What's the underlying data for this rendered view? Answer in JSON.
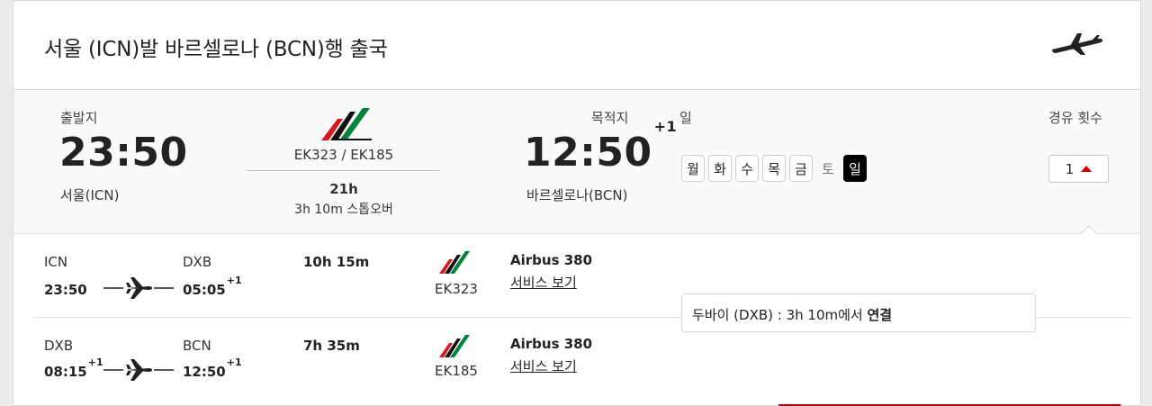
{
  "header": {
    "title": "서울 (ICN)발 바르셀로나 (BCN)행 출국",
    "icon": "plane-icon"
  },
  "summary": {
    "departure_label": "출발지",
    "departure_time": "23:50",
    "departure_city": "서울(ICN)",
    "flights": "EK323 / EK185",
    "total_duration": "21h",
    "stopover": "3h 10m 스톱오버",
    "arrival_label": "목적지",
    "arrival_time": "12:50",
    "arrival_day_offset": "+1",
    "arrival_city": "바르셀로나(BCN)",
    "days_label": "일",
    "days": [
      {
        "label": "월",
        "state": "available"
      },
      {
        "label": "화",
        "state": "available"
      },
      {
        "label": "수",
        "state": "available"
      },
      {
        "label": "목",
        "state": "available"
      },
      {
        "label": "금",
        "state": "available"
      },
      {
        "label": "토",
        "state": "unavailable"
      },
      {
        "label": "일",
        "state": "selected"
      }
    ],
    "stops_label": "경유 횟수",
    "stops_value": "1"
  },
  "segments": [
    {
      "from_code": "ICN",
      "from_time": "23:50",
      "from_offset": "",
      "to_code": "DXB",
      "to_time": "05:05",
      "to_offset": "+1",
      "duration": "10h 15m",
      "flight_no": "EK323",
      "aircraft": "Airbus 380",
      "service_link": "서비스 보기"
    },
    {
      "from_code": "DXB",
      "from_time": "08:15",
      "from_offset": "+1",
      "to_code": "BCN",
      "to_time": "12:50",
      "to_offset": "+1",
      "duration": "7h 35m",
      "flight_no": "EK185",
      "aircraft": "Airbus 380",
      "service_link": "서비스 보기"
    }
  ],
  "layover": {
    "text": "두바이 (DXB) : 3h 10m에서 ",
    "bold": "연결"
  },
  "colors": {
    "accent_red": "#c00000",
    "selected_day_bg": "#000000",
    "emirates_red": "#d71921",
    "emirates_green": "#00843d"
  }
}
